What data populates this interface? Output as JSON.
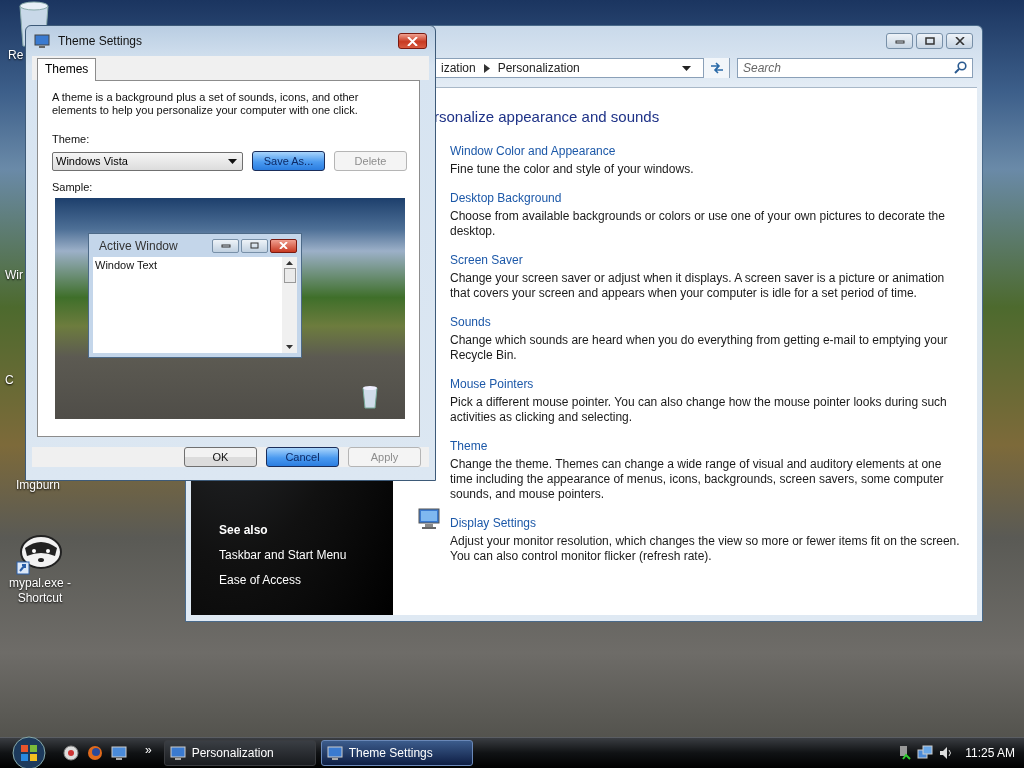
{
  "desktop_icons": [
    {
      "label": "Re",
      "kind": "recycle"
    },
    {
      "label": "Wir",
      "kind": "edge"
    },
    {
      "label": "C",
      "kind": "edge"
    },
    {
      "label": "Imgburn",
      "kind": "plain"
    },
    {
      "label": "mypal.exe - Shortcut",
      "kind": "raccoon"
    }
  ],
  "personalization_window": {
    "breadcrumb": [
      "ization",
      "Personalization"
    ],
    "search": {
      "placeholder": "Search"
    },
    "see_also": {
      "title": "See also",
      "links": [
        "Taskbar and Start Menu",
        "Ease of Access"
      ]
    },
    "heading": "rsonalize appearance and sounds",
    "items": [
      {
        "title": "Window Color and Appearance",
        "description": "Fine tune the color and style of your windows.",
        "icon": false
      },
      {
        "title": "Desktop Background",
        "description": "Choose from available backgrounds or colors or use one of your own pictures to decorate the desktop.",
        "icon": false
      },
      {
        "title": "Screen Saver",
        "description": "Change your screen saver or adjust when it displays. A screen saver is a picture or animation that covers your screen and appears when your computer is idle for a set period of time.",
        "icon": false
      },
      {
        "title": "Sounds",
        "description": "Change which sounds are heard when you do everything from getting e-mail to emptying your Recycle Bin.",
        "icon": false
      },
      {
        "title": "Mouse Pointers",
        "description": "Pick a different mouse pointer. You can also change how the mouse pointer looks during such activities as clicking and selecting.",
        "icon": false
      },
      {
        "title": "Theme",
        "description": "Change the theme. Themes can change a wide range of visual and auditory elements at one time including the appearance of menus, icons, backgrounds, screen savers, some computer sounds, and mouse pointers.",
        "icon": false
      },
      {
        "title": "Display Settings",
        "description": "Adjust your monitor resolution, which changes the view so more or fewer items fit on the screen. You can also control monitor flicker (refresh rate).",
        "icon": true
      }
    ]
  },
  "theme_dialog": {
    "title": "Theme Settings",
    "tabs": [
      {
        "label": "Themes",
        "selected": true
      }
    ],
    "description": "A theme is a background plus a set of sounds, icons, and other elements to help you personalize your computer with one click.",
    "theme_label": "Theme:",
    "theme_value": "Windows Vista",
    "theme_buttons": [
      {
        "label": "Save As...",
        "default": true,
        "disabled": false
      },
      {
        "label": "Delete",
        "default": false,
        "disabled": true
      }
    ],
    "sample_label": "Sample:",
    "sample": {
      "window_title": "Active Window",
      "window_text": "Window Text"
    },
    "buttons": [
      {
        "label": "OK",
        "default": false,
        "disabled": false
      },
      {
        "label": "Cancel",
        "default": true,
        "disabled": false
      },
      {
        "label": "Apply",
        "default": false,
        "disabled": true
      }
    ]
  },
  "taskbar": {
    "overflow": "»",
    "tasks": [
      {
        "label": "Personalization",
        "selected": false
      },
      {
        "label": "Theme Settings",
        "selected": true
      }
    ],
    "clock": "11:25 AM"
  }
}
